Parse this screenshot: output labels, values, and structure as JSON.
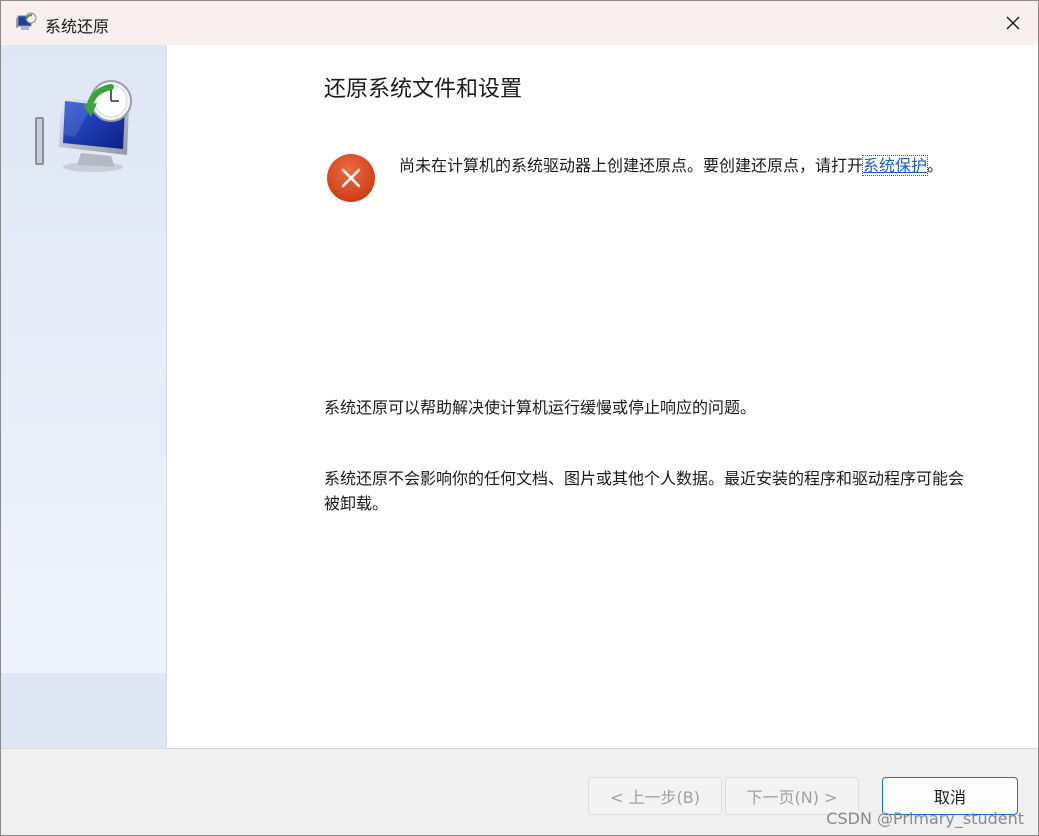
{
  "window": {
    "title": "系统还原"
  },
  "main": {
    "heading": "还原系统文件和设置",
    "error_message": "尚未在计算机的系统驱动器上创建还原点。要创建还原点，请打开",
    "link_text": "系统保护",
    "error_suffix": "。",
    "paragraph1": "系统还原可以帮助解决使计算机运行缓慢或停止响应的问题。",
    "paragraph2": "系统还原不会影响你的任何文档、图片或其他个人数据。最近安装的程序和驱动程序可能会被卸载。"
  },
  "footer": {
    "back_label": "< 上一步(B)",
    "next_label": "下一页(N) >",
    "cancel_label": "取消"
  },
  "watermark": "CSDN @Primary_student",
  "colors": {
    "accent": "#1f6fcf",
    "error": "#d9461d",
    "link": "#1b5fb5",
    "titlebar": "#f8efee",
    "sidebar": "#e6edf8"
  },
  "icons": [
    "system-restore-icon",
    "close-icon",
    "monitor-clock-icon",
    "error-icon"
  ]
}
